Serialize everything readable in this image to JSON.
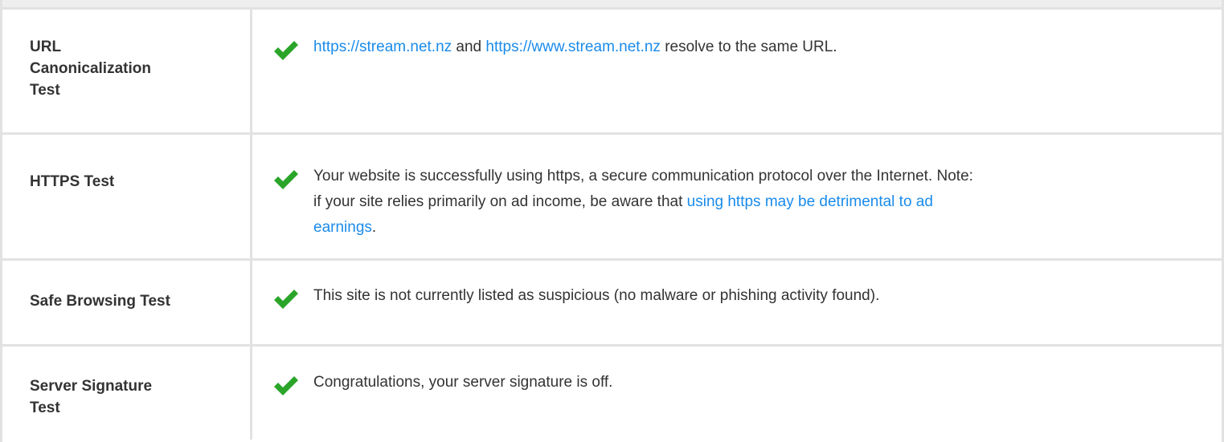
{
  "colors": {
    "check": "#2aa52a",
    "link": "#1a8bea",
    "text": "#333333",
    "border": "#e2e2e2"
  },
  "rows": [
    {
      "label": "URL Canonicalization Test",
      "label_lines": [
        "URL",
        "Canonicalization",
        "Test"
      ],
      "icon": "check-icon",
      "message": {
        "link1": "https://stream.net.nz",
        "between": " and ",
        "link2": "https://www.stream.net.nz",
        "after": " resolve to the same URL."
      }
    },
    {
      "label": "HTTPS Test",
      "icon": "check-icon",
      "message": {
        "before": "Your website is successfully using https, a secure communication protocol over the Internet. Note: if your site relies primarily on ad income, be aware that ",
        "link": "using https may be detrimental to ad earnings",
        "after": "."
      }
    },
    {
      "label": "Safe Browsing Test",
      "icon": "check-icon",
      "message": {
        "text": "This site is not currently listed as suspicious (no malware or phishing activity found)."
      }
    },
    {
      "label": "Server Signature Test",
      "label_lines": [
        "Server Signature",
        "Test"
      ],
      "icon": "check-icon",
      "message": {
        "text": "Congratulations, your server signature is off."
      }
    }
  ]
}
